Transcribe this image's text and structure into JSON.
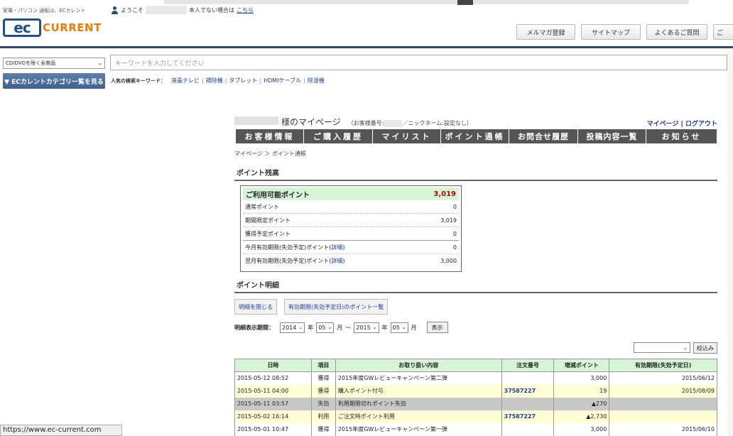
{
  "header": {
    "tagline": "家電・パソコン 通販は、ECカレント",
    "welcome_prefix": "ようこそ",
    "welcome_suffix": "本人でない場合は",
    "welcome_link": "こちら",
    "logo_ec": "ec",
    "logo_current": "CURRENT",
    "nav": [
      "メルマガ登録",
      "サイトマップ",
      "よくあるご質問",
      "ご"
    ]
  },
  "search": {
    "category_selected": "CD/DVDを除く全商品",
    "placeholder": "キーワードを入力してください",
    "category_button": "▼ ECカレントカテゴリ一覧を見る",
    "popular_label": "人気の検索キーワード：",
    "keywords": [
      "液晶テレビ",
      "掃除機",
      "タブレット",
      "HDMIケーブル",
      "除湿機"
    ]
  },
  "mypage": {
    "title_suffix": "様のマイページ",
    "sub_prefix": "（お客様番号:",
    "sub_suffix": "／ニックネーム:設定なし）",
    "link_mypage": "マイページ",
    "link_sep": "|",
    "link_logout": "ログアウト",
    "tabs": [
      "お客様情報",
      "ご購入履歴",
      "マイリスト",
      "ポイント通帳",
      "お問合せ履歴",
      "投稿内容一覧",
      "お知らせ"
    ],
    "breadcrumb_home": "マイページ",
    "breadcrumb_sep": "＞",
    "breadcrumb_current": "ポイント通帳"
  },
  "balance": {
    "heading": "ポイント残高",
    "available_label": "ご利用可能ポイント",
    "available_value": "3,019",
    "rows": [
      {
        "label": "通常ポイント",
        "value": "0"
      },
      {
        "label": "期間限定ポイント",
        "value": "3,019"
      },
      {
        "label": "獲得予定ポイント",
        "value": "0"
      },
      {
        "label": "今月有効期限(失効予定)ポイント",
        "link": "詳細",
        "value": "0"
      },
      {
        "label": "翌月有効期限(失効予定)ポイント",
        "link": "詳細",
        "value": "3,000"
      }
    ]
  },
  "detail": {
    "heading": "ポイント明細",
    "close_button": "明細を閉じる",
    "expiry_button": "有効期限(失効予定日)のポイント一覧",
    "period_label": "明細表示期間：",
    "from_year": "2014",
    "from_month": "05",
    "to_year": "2015",
    "to_month": "05",
    "year_unit": "年",
    "month_unit": "月",
    "tilde": "〜",
    "display_button": "表示",
    "filter_button": "絞込み",
    "columns": [
      "日時",
      "項目",
      "お取り扱い内容",
      "注文番号",
      "増減ポイント",
      "有効期限(失効予定日)"
    ],
    "rows": [
      {
        "date": "2015-05-12 08:52",
        "type": "獲得",
        "desc": "2015年度GWレビューキャンペーン第二弾",
        "order": "",
        "points": "3,000",
        "expiry": "2015/06/12",
        "style": "r-white"
      },
      {
        "date": "2015-05-11 04:00",
        "type": "獲得",
        "desc": "購入ポイント付与",
        "order": "37587227",
        "points": "19",
        "expiry": "2015/08/09",
        "style": "r-yellow"
      },
      {
        "date": "2015-05-11 03:57",
        "type": "失効",
        "desc": "利用期限切れポイント失効",
        "order": "",
        "points": "▲270",
        "expiry": "",
        "style": "r-gray"
      },
      {
        "date": "2015-05-02 16:14",
        "type": "利用",
        "desc": "ご注文時ポイント利用",
        "order": "37587227",
        "points": "▲2,730",
        "expiry": "",
        "style": "r-yellow"
      },
      {
        "date": "2015-05-01 10:47",
        "type": "獲得",
        "desc": "2015年度GWレビューキャンペーン第一弾",
        "order": "",
        "points": "3,000",
        "expiry": "2015/06/10",
        "style": "r-white"
      }
    ]
  },
  "statusbar": "https://www.ec-current.com"
}
